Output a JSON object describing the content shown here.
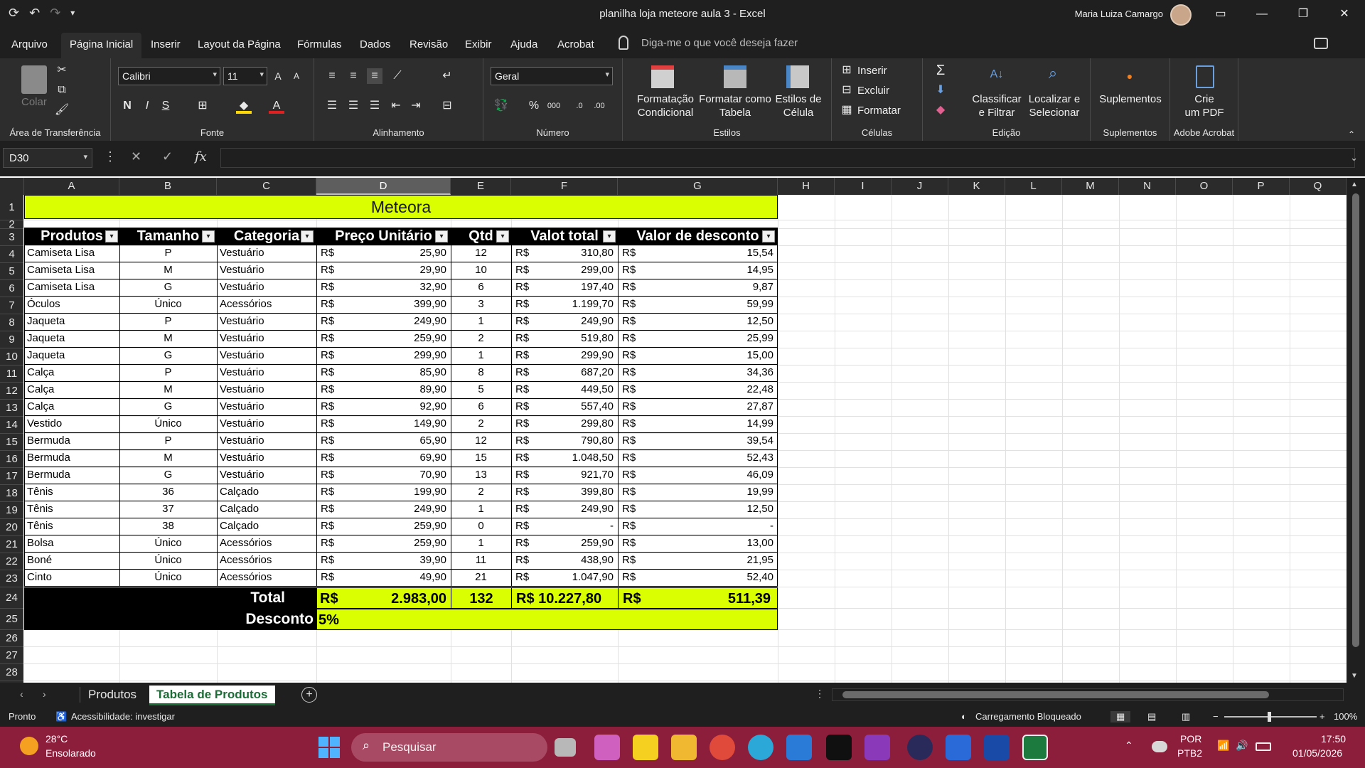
{
  "window": {
    "title": "planilha loja meteore aula 3  -  Excel",
    "user": "Maria Luiza Camargo"
  },
  "menu": {
    "tabs": [
      "Arquivo",
      "Página Inicial",
      "Inserir",
      "Layout da Página",
      "Fórmulas",
      "Dados",
      "Revisão",
      "Exibir",
      "Ajuda",
      "Acrobat"
    ],
    "active_tab": "Página Inicial",
    "tell_me": "Diga-me o que você deseja fazer"
  },
  "ribbon": {
    "clipboard": {
      "label": "Área de Transferência",
      "paste": "Colar"
    },
    "font": {
      "label": "Fonte",
      "font_name": "Calibri",
      "font_size": "11",
      "bold": "N",
      "italic": "I",
      "underline": "S"
    },
    "alignment": {
      "label": "Alinhamento"
    },
    "number": {
      "label": "Número",
      "format": "Geral",
      "percent": "%",
      "thousands": "000"
    },
    "styles": {
      "label": "Estilos",
      "cond_format": "Formatação\nCondicional",
      "format_table": "Formatar como\nTabela",
      "cell_styles": "Estilos de\nCélula"
    },
    "cells": {
      "label": "Células",
      "insert": "Inserir",
      "delete": "Excluir",
      "format": "Formatar"
    },
    "editing": {
      "label": "Edição",
      "sort_filter": "Classificar\ne Filtrar",
      "find_select": "Localizar e\nSelecionar"
    },
    "addins": {
      "label": "Suplementos",
      "button": "Suplementos"
    },
    "acrobat": {
      "label": "Adobe Acrobat",
      "button": "Crie\num PDF"
    }
  },
  "formula_bar": {
    "name_box": "D30",
    "fx": "fx",
    "value": ""
  },
  "columns": [
    "A",
    "B",
    "C",
    "D",
    "E",
    "F",
    "G",
    "H",
    "I",
    "J",
    "K",
    "L",
    "M",
    "N",
    "O",
    "P",
    "Q"
  ],
  "rows": [
    "1",
    "2",
    "3",
    "4",
    "5",
    "6",
    "7",
    "8",
    "9",
    "10",
    "11",
    "12",
    "13",
    "14",
    "15",
    "16",
    "17",
    "18",
    "19",
    "20",
    "21",
    "22",
    "23",
    "24",
    "25",
    "26",
    "27",
    "28"
  ],
  "sheet": {
    "banner": "Meteora",
    "headers": [
      "Produtos",
      "Tamanho",
      "Categoria",
      "Preço Unitário",
      "Qtd",
      "Valot total",
      "Valor de desconto"
    ],
    "currency": "R$",
    "data": [
      [
        "Camiseta Lisa",
        "P",
        "Vestuário",
        "25,90",
        "12",
        "310,80",
        "15,54"
      ],
      [
        "Camiseta Lisa",
        "M",
        "Vestuário",
        "29,90",
        "10",
        "299,00",
        "14,95"
      ],
      [
        "Camiseta Lisa",
        "G",
        "Vestuário",
        "32,90",
        "6",
        "197,40",
        "9,87"
      ],
      [
        "Óculos",
        "Único",
        "Acessórios",
        "399,90",
        "3",
        "1.199,70",
        "59,99"
      ],
      [
        "Jaqueta",
        "P",
        "Vestuário",
        "249,90",
        "1",
        "249,90",
        "12,50"
      ],
      [
        "Jaqueta",
        "M",
        "Vestuário",
        "259,90",
        "2",
        "519,80",
        "25,99"
      ],
      [
        "Jaqueta",
        "G",
        "Vestuário",
        "299,90",
        "1",
        "299,90",
        "15,00"
      ],
      [
        "Calça",
        "P",
        "Vestuário",
        "85,90",
        "8",
        "687,20",
        "34,36"
      ],
      [
        "Calça",
        "M",
        "Vestuário",
        "89,90",
        "5",
        "449,50",
        "22,48"
      ],
      [
        "Calça",
        "G",
        "Vestuário",
        "92,90",
        "6",
        "557,40",
        "27,87"
      ],
      [
        "Vestido",
        "Único",
        "Vestuário",
        "149,90",
        "2",
        "299,80",
        "14,99"
      ],
      [
        "Bermuda",
        "P",
        "Vestuário",
        "65,90",
        "12",
        "790,80",
        "39,54"
      ],
      [
        "Bermuda",
        "M",
        "Vestuário",
        "69,90",
        "15",
        "1.048,50",
        "52,43"
      ],
      [
        "Bermuda",
        "G",
        "Vestuário",
        "70,90",
        "13",
        "921,70",
        "46,09"
      ],
      [
        "Tênis",
        "36",
        "Calçado",
        "199,90",
        "2",
        "399,80",
        "19,99"
      ],
      [
        "Tênis",
        "37",
        "Calçado",
        "249,90",
        "1",
        "249,90",
        "12,50"
      ],
      [
        "Tênis",
        "38",
        "Calçado",
        "259,90",
        "0",
        "-",
        "-"
      ],
      [
        "Bolsa",
        "Único",
        "Acessórios",
        "259,90",
        "1",
        "259,90",
        "13,00"
      ],
      [
        "Boné",
        "Único",
        "Acessórios",
        "39,90",
        "11",
        "438,90",
        "21,95"
      ],
      [
        "Cinto",
        "Único",
        "Acessórios",
        "49,90",
        "21",
        "1.047,90",
        "52,40"
      ]
    ],
    "total_label": "Total",
    "total_price": "2.983,00",
    "total_qty": "132",
    "total_value": "R$ 10.227,80",
    "total_discount": "511,39",
    "discount_label": "Desconto",
    "discount_rate": "5%"
  },
  "sheet_tabs": [
    "Produtos",
    "Tabela de Produtos"
  ],
  "active_sheet": "Tabela de Produtos",
  "status": {
    "ready": "Pronto",
    "accessibility": "Acessibilidade: investigar",
    "loading": "Carregamento Bloqueado",
    "zoom": "100%"
  },
  "taskbar": {
    "temp": "28°C",
    "weather": "Ensolarado",
    "search": "Pesquisar",
    "lang1": "POR",
    "lang2": "PTB2",
    "time": "17:50",
    "date": "01/05/2026"
  },
  "colors": {
    "accent_yellow": "#d9ff00",
    "excel_green": "#1c6c36",
    "taskbar": "#8c1e3b"
  }
}
